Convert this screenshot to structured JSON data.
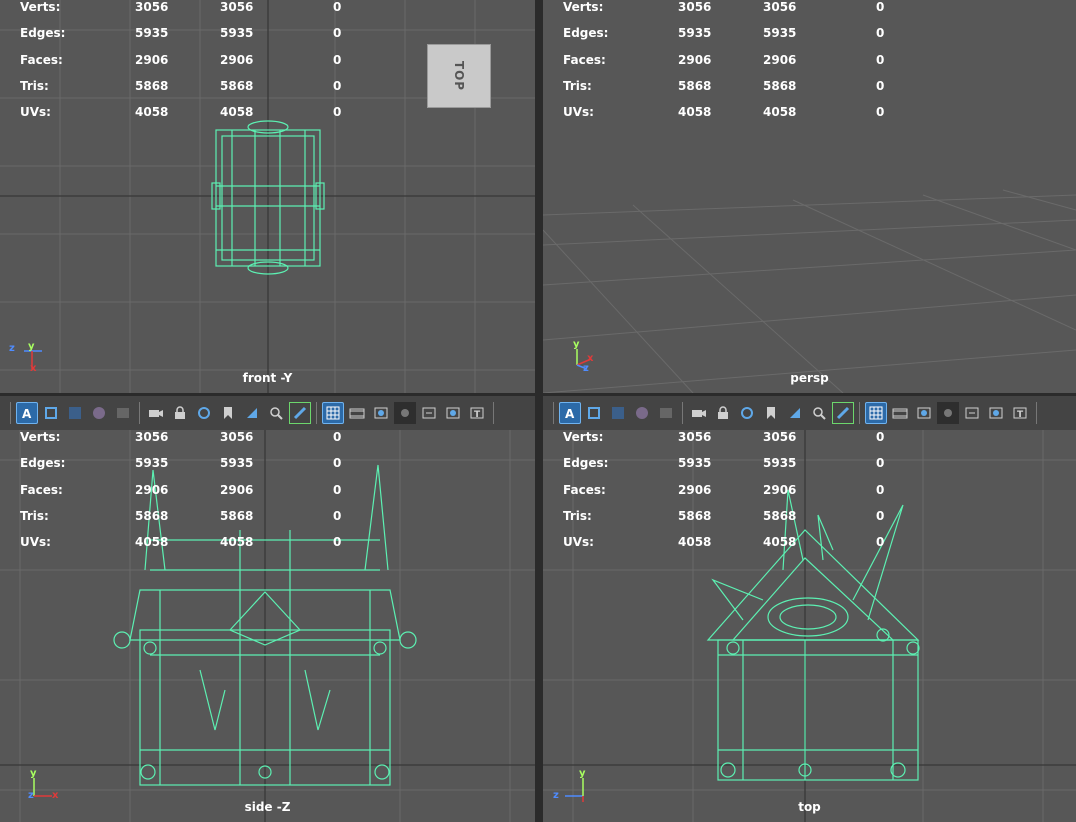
{
  "hud": {
    "rows": [
      {
        "label": "Verts:",
        "a": "3056",
        "b": "3056",
        "c": "0"
      },
      {
        "label": "Edges:",
        "a": "5935",
        "b": "5935",
        "c": "0"
      },
      {
        "label": "Faces:",
        "a": "2906",
        "b": "2906",
        "c": "0"
      },
      {
        "label": "Tris:",
        "a": "5868",
        "b": "5868",
        "c": "0"
      },
      {
        "label": "UVs:",
        "a": "4058",
        "b": "4058",
        "c": "0"
      }
    ]
  },
  "viewports": {
    "front": {
      "label": "front -Y",
      "axis": {
        "h": "z",
        "v": "y",
        "d": "x"
      }
    },
    "persp": {
      "label": "persp",
      "axis": {
        "h": "z",
        "v": "y",
        "d": "x"
      }
    },
    "side": {
      "label": "side -Z",
      "axis": {
        "h": "z",
        "v": "y",
        "d": "x"
      }
    },
    "top": {
      "label": "top",
      "axis": {
        "h": "z",
        "v": "y",
        "d": "x"
      }
    }
  },
  "viewcube": {
    "face": "TOP"
  },
  "colors": {
    "wire": "#5cf0b2",
    "grid": "#6a6a6a",
    "grid_dark": "#3f3f3f",
    "bg": "#575757"
  }
}
